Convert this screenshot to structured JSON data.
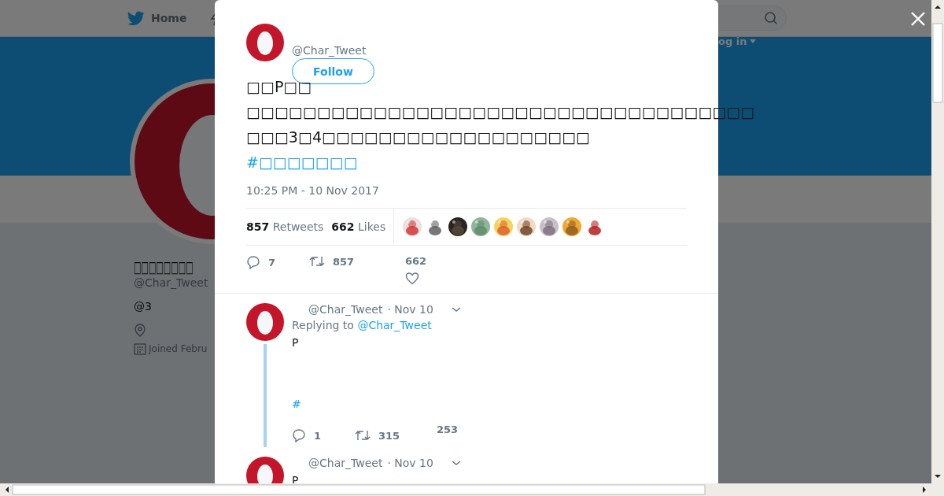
{
  "nav": {
    "home": "Home",
    "login": "og in"
  },
  "profile": {
    "name": "□□□□□□□□",
    "handle": "@Char_Tweet",
    "bio": "@3",
    "joined": "Joined Febru"
  },
  "tweet": {
    "handle": "@Char_Tweet",
    "follow": "Follow",
    "lines": [
      "□□P□□",
      "□□□□□□□□□□□□□□□□□□□□□□□□□□□□□□□□□□□□",
      "□□□3□4□□□□□□□□□□□□□□□□□□□"
    ],
    "hashtag": "#□□□□□□□",
    "time": "10:25 PM - 10 Nov 2017",
    "retweets": {
      "count": "857",
      "label": "Retweets"
    },
    "likes": {
      "count": "662",
      "label": "Likes"
    },
    "actions": {
      "reply": "7",
      "retweet": "857",
      "like": "662"
    }
  },
  "replies": [
    {
      "handle": "@Char_Tweet",
      "date": "· Nov 10",
      "replying_label": "Replying to",
      "replying_to": "@Char_Tweet",
      "text": "P",
      "hashtag": "#",
      "actions": {
        "reply": "1",
        "retweet": "315",
        "like": "253"
      }
    },
    {
      "handle": "@Char_Tweet",
      "date": "· Nov 10",
      "text": "P"
    }
  ]
}
